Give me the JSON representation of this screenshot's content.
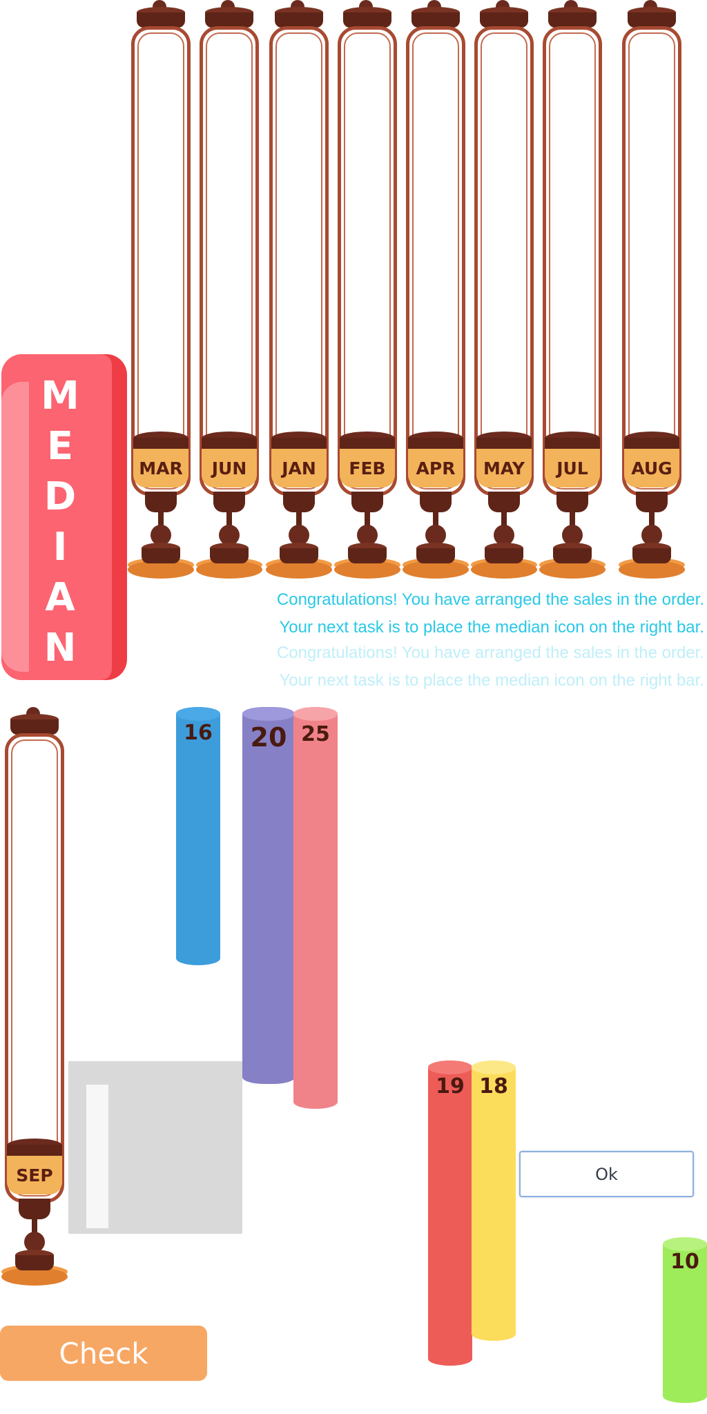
{
  "median_label": "MEDIAN",
  "median_letters": [
    "M",
    "E",
    "D",
    "I",
    "A",
    "N"
  ],
  "months": {
    "tube_0": "MAR",
    "tube_1": "JUN",
    "tube_2": "JAN",
    "tube_3": "FEB",
    "tube_4": "APR",
    "tube_5": "MAY",
    "tube_6": "JUL",
    "tube_7": "AUG",
    "tube_8": "SEP"
  },
  "messages": {
    "congrats": "Congratulations! You have arranged the sales in the order.",
    "next_task": "Your next task is to place the median icon on the right bar."
  },
  "bars": [
    {
      "value": "16",
      "color": "#3d9ddb",
      "top_color": "#4aa9e6"
    },
    {
      "value": "20",
      "color": "#8680c6",
      "top_color": "#9e98dc"
    },
    {
      "value": "25",
      "color": "#f08389",
      "top_color": "#f7a4a9"
    },
    {
      "value": "19",
      "color": "#ee5c58",
      "top_color": "#f47a76"
    },
    {
      "value": "18",
      "color": "#fcdc5b",
      "top_color": "#fde887"
    },
    {
      "value": "10",
      "color": "#9eec5a",
      "top_color": "#b8f27e"
    }
  ],
  "buttons": {
    "check": "Check",
    "ok": "Ok"
  },
  "colors": {
    "tube_frame": "#a84a32",
    "label": "#f3b35a",
    "median_badge": "#fb6470",
    "message": "#29c9e6",
    "check_button": "#f7a764"
  }
}
